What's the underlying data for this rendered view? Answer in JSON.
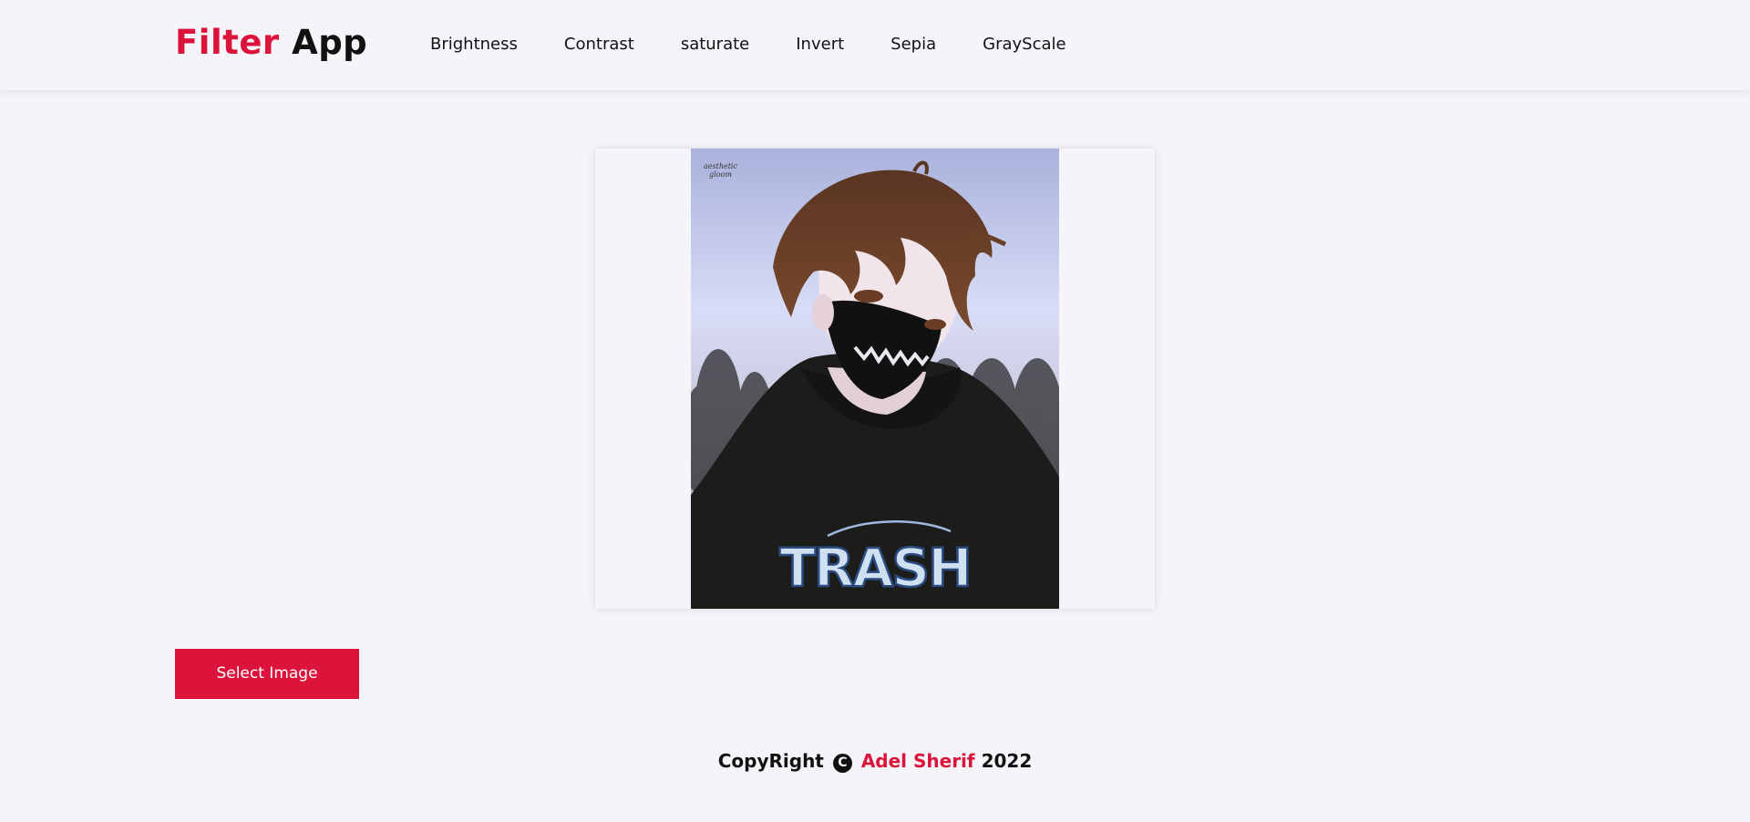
{
  "header": {
    "logo_accent": "Filter",
    "logo_rest": "App",
    "nav": [
      "Brightness",
      "Contrast",
      "saturate",
      "Invert",
      "Sepia",
      "GrayScale"
    ]
  },
  "preview": {
    "watermark": "aesthetic gloom",
    "shirt_text": "TRASH"
  },
  "actions": {
    "select_label": "Select Image"
  },
  "footer": {
    "prefix": "CopyRight",
    "icon": "copyright-icon",
    "author": "Adel Sherif",
    "year": "2022"
  },
  "colors": {
    "accent": "#dc143c",
    "background": "#f5f4f9",
    "text": "#111111"
  }
}
